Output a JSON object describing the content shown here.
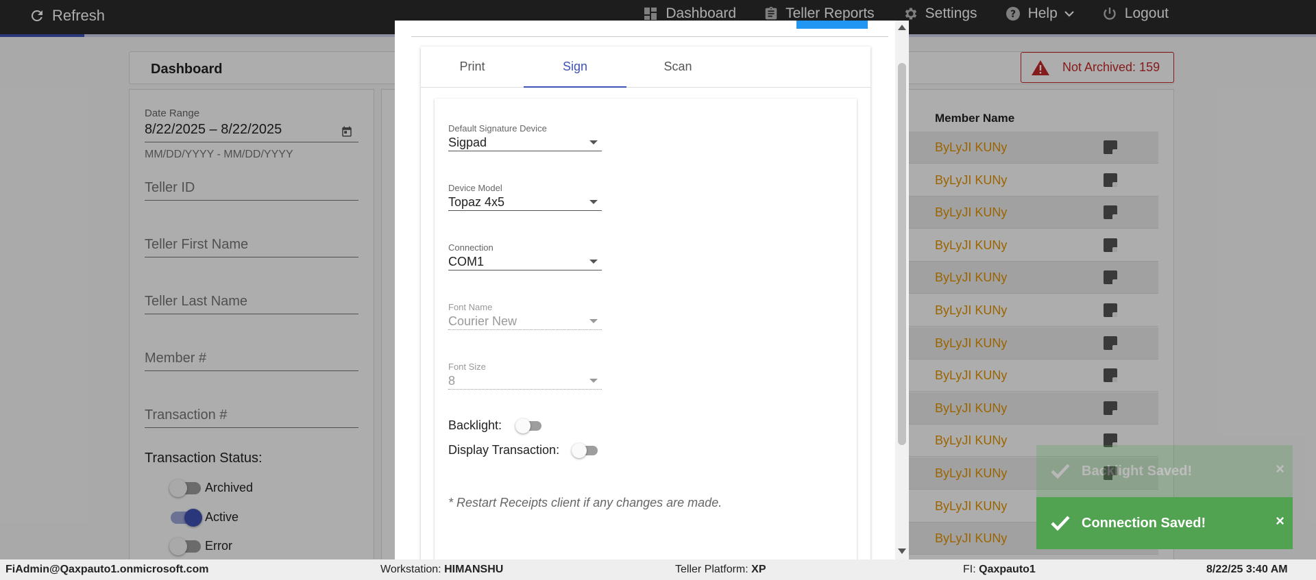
{
  "topbar": {
    "refresh_label": "Refresh",
    "nav": {
      "dashboard": "Dashboard",
      "teller_reports": "Teller Reports",
      "settings": "Settings",
      "help": "Help",
      "logout": "Logout"
    }
  },
  "dashboard": {
    "title": "Dashboard",
    "not_archived": "Not Archived: 159"
  },
  "filters": {
    "date_range_label": "Date Range",
    "date_range_value": "8/22/2025 – 8/22/2025",
    "date_range_hint": "MM/DD/YYYY - MM/DD/YYYY",
    "teller_id": "Teller ID",
    "teller_first_name": "Teller First Name",
    "teller_last_name": "Teller Last Name",
    "member_number": "Member #",
    "transaction_number": "Transaction #",
    "transaction_status_title": "Transaction Status:",
    "statuses": [
      {
        "label": "Archived",
        "on": false
      },
      {
        "label": "Active",
        "on": true
      },
      {
        "label": "Error",
        "on": false
      }
    ]
  },
  "table": {
    "column_member_name": "Member Name",
    "rows": [
      "ByLyJI KUNy",
      "ByLyJI KUNy",
      "ByLyJI KUNy",
      "ByLyJI KUNy",
      "ByLyJI KUNy",
      "ByLyJI KUNy",
      "ByLyJI KUNy",
      "ByLyJI KUNy",
      "ByLyJI KUNy",
      "ByLyJI KUNy",
      "ByLyJI KUNy",
      "ByLyJI KUNy",
      "ByLyJI KUNy"
    ]
  },
  "modal": {
    "tabs": [
      "Print",
      "Sign",
      "Scan"
    ],
    "active_tab": "Sign",
    "fields": {
      "signature_device": {
        "label": "Default Signature Device",
        "value": "Sigpad"
      },
      "device_model": {
        "label": "Device Model",
        "value": "Topaz 4x5"
      },
      "connection": {
        "label": "Connection",
        "value": "COM1"
      },
      "font_name": {
        "label": "Font Name",
        "value": "Courier New"
      },
      "font_size": {
        "label": "Font Size",
        "value": "8"
      }
    },
    "backlight_label": "Backlight:",
    "backlight_on": false,
    "display_transaction_label": "Display Transaction:",
    "display_transaction_on": false,
    "restart_note": "* Restart Receipts client if any changes are made."
  },
  "toasts": [
    {
      "text": "Backlight Saved!",
      "close": "×"
    },
    {
      "text": "Connection Saved!",
      "close": "×"
    }
  ],
  "statusbar": {
    "user": "FiAdmin@Qaxpauto1.onmicrosoft.com",
    "workstation_label": "Workstation:",
    "workstation": "HIMANSHU",
    "platform_label": "Teller Platform:",
    "platform": "XP",
    "fi_label": "FI:",
    "fi": "Qaxpauto1",
    "datetime": "8/22/25 3:40 AM"
  },
  "colors": {
    "accent": "#3f51b5",
    "member_link": "#e59400",
    "toast_success": "#51a351",
    "error_red": "#c62828"
  }
}
